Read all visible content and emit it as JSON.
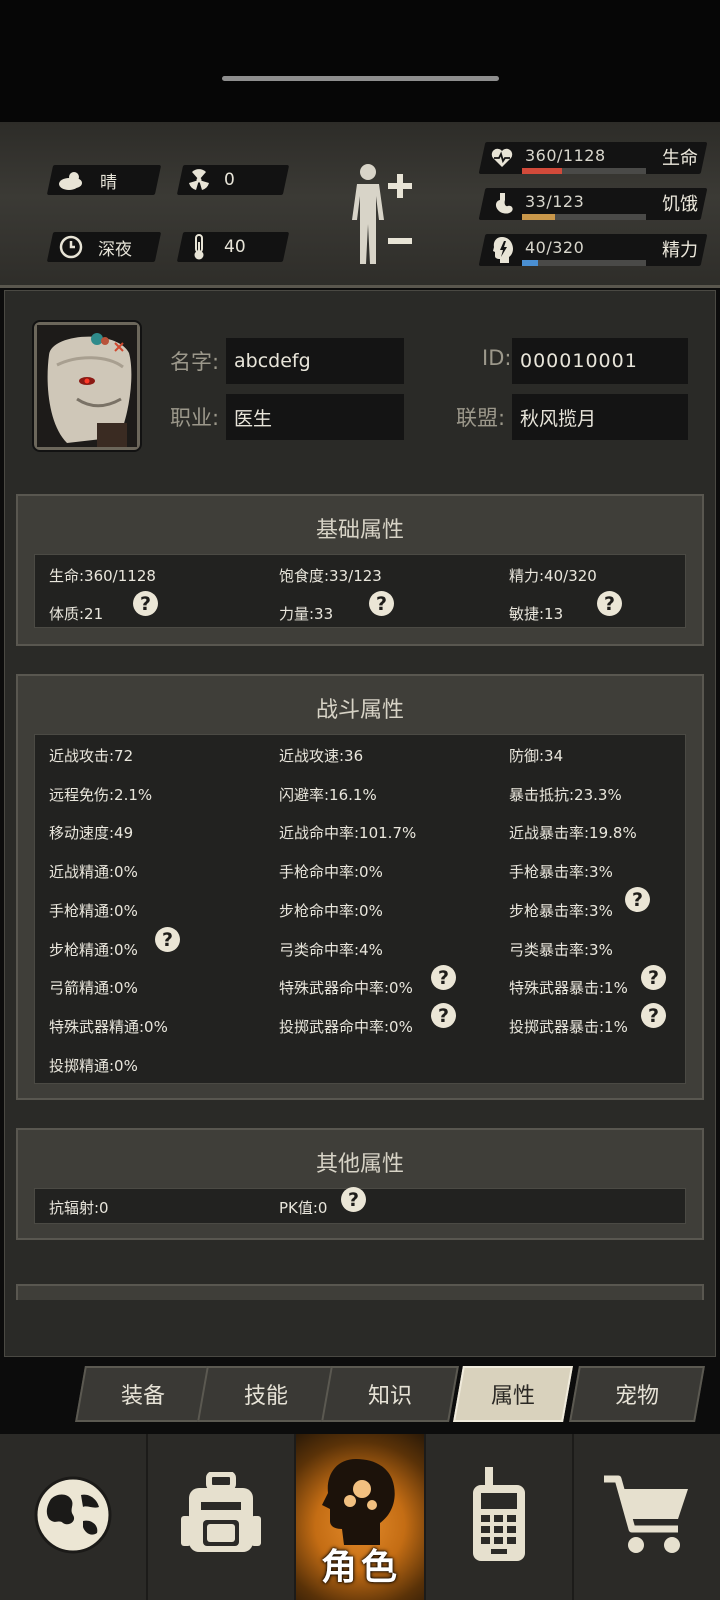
{
  "status": {
    "weather": "晴",
    "radiation": "0",
    "time_of_day": "深夜",
    "temperature": "40",
    "health": {
      "value": "360/1128",
      "label": "生命",
      "fill": 0.32,
      "color": "#d24a3a"
    },
    "hunger": {
      "value": "33/123",
      "label": "饥饿",
      "fill": 0.27,
      "color": "#c9974a"
    },
    "energy": {
      "value": "40/320",
      "label": "精力",
      "fill": 0.125,
      "color": "#4a8fd2"
    }
  },
  "profile": {
    "name_label": "名字:",
    "name": "abcdefg",
    "id_label": "ID:",
    "id": "000010001",
    "job_label": "职业:",
    "job": "医生",
    "alliance_label": "联盟:",
    "alliance": "秋风揽月"
  },
  "basic": {
    "title": "基础属性",
    "items": [
      "生命:360/1128",
      "饱食度:33/123",
      "精力:40/320",
      "体质:21",
      "力量:33",
      "敏捷:13"
    ]
  },
  "combat": {
    "title": "战斗属性",
    "items": [
      "近战攻击:72",
      "近战攻速:36",
      "防御:34",
      "远程免伤:2.1%",
      "闪避率:16.1%",
      "暴击抵抗:23.3%",
      "移动速度:49",
      "近战命中率:101.7%",
      "近战暴击率:19.8%",
      "近战精通:0%",
      "手枪命中率:0%",
      "手枪暴击率:3%",
      "手枪精通:0%",
      "步枪命中率:0%",
      "步枪暴击率:3%",
      "步枪精通:0%",
      "弓类命中率:4%",
      "弓类暴击率:3%",
      "弓箭精通:0%",
      "特殊武器命中率:0%",
      "特殊武器暴击:1%",
      "特殊武器精通:0%",
      "投掷武器命中率:0%",
      "投掷武器暴击:1%",
      "投掷精通:0%"
    ]
  },
  "other": {
    "title": "其他属性",
    "items": [
      "抗辐射:0",
      "PK值:0"
    ]
  },
  "tabs": [
    "装备",
    "技能",
    "知识",
    "属性",
    "宠物"
  ],
  "nav": {
    "active_label": "角色",
    "items": [
      "world-map",
      "backpack",
      "character",
      "radio",
      "shop"
    ]
  },
  "help_mark": "?"
}
